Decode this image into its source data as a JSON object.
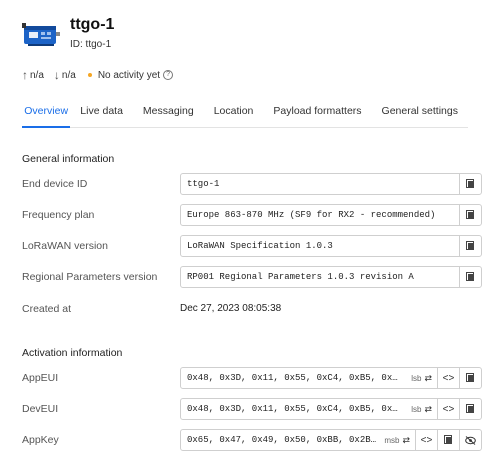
{
  "device": {
    "name": "ttgo-1",
    "id_label": "ID: ttgo-1"
  },
  "stats": {
    "uplink": "n/a",
    "downlink": "n/a",
    "activity": "No activity yet"
  },
  "tabs": [
    "Overview",
    "Live data",
    "Messaging",
    "Location",
    "Payload formatters",
    "General settings"
  ],
  "active_tab": "Overview",
  "general": {
    "title": "General information",
    "end_device_id": {
      "label": "End device ID",
      "value": "ttgo-1"
    },
    "frequency_plan": {
      "label": "Frequency plan",
      "value": "Europe 863-870 MHz (SF9 for RX2 - recommended)"
    },
    "lorawan_version": {
      "label": "LoRaWAN version",
      "value": "LoRaWAN Specification 1.0.3"
    },
    "regional_params": {
      "label": "Regional Parameters version",
      "value": "RP001 Regional Parameters 1.0.3 revision A"
    },
    "created_at": {
      "label": "Created at",
      "value": "Dec 27, 2023 08:05:38"
    }
  },
  "activation": {
    "title": "Activation information",
    "app_eui": {
      "label": "AppEUI",
      "value": "0x48, 0x3D, 0x11, 0x55, 0xC4, 0xB5, 0x…",
      "tag": "lsb"
    },
    "dev_eui": {
      "label": "DevEUI",
      "value": "0x48, 0x3D, 0x11, 0x55, 0xC4, 0xB5, 0x…",
      "tag": "lsb"
    },
    "app_key": {
      "label": "AppKey",
      "value": "0x65, 0x47, 0x49, 0x50, 0xBB, 0x2B…",
      "tag": "msb"
    }
  },
  "icons": {
    "device": "device-board-icon",
    "up": "arrow-up-icon",
    "down": "arrow-down-icon",
    "status": "status-dot-icon",
    "help": "help-icon",
    "copy": "copy-icon",
    "code": "code-icon",
    "swap": "swap-icon",
    "hide": "eye-off-icon"
  },
  "colors": {
    "accent": "#1a6ee8",
    "status_dot": "#f5a623"
  }
}
